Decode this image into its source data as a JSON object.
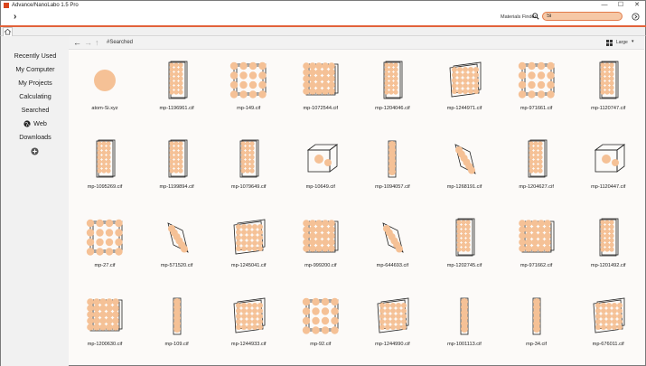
{
  "window": {
    "title": "Advance/NanoLabo 1.5 Pro",
    "controls": [
      "—",
      "☐",
      "✕"
    ]
  },
  "toolbar": {
    "menu_glyph": "›",
    "finder_label": "Materials Finder",
    "finder_value": "Si"
  },
  "sidebar": {
    "items": [
      {
        "label": "Recently Used"
      },
      {
        "label": "My Computer"
      },
      {
        "label": "My Projects"
      },
      {
        "label": "Calculating"
      },
      {
        "label": "Searched"
      },
      {
        "label": "Web",
        "icon": "globe-icon"
      },
      {
        "label": "Downloads"
      }
    ],
    "add_icon": "plus-circle-icon"
  },
  "navbar": {
    "back": "←",
    "forward": "→",
    "up": "↑",
    "breadcrumb": "#Searched",
    "view_label": "Large",
    "view_caret": "▾"
  },
  "colors": {
    "accent": "#e2623a",
    "atom": "#f5c196",
    "search_bg": "#f6c8a6"
  },
  "files": [
    {
      "name": "atom-Si.xyz",
      "kind": "atom"
    },
    {
      "name": "mp-1196961.cif",
      "kind": "tall"
    },
    {
      "name": "mp-149.cif",
      "kind": "cube-lattice"
    },
    {
      "name": "mp-1072544.cif",
      "kind": "cube-dense"
    },
    {
      "name": "mp-1204046.cif",
      "kind": "tall"
    },
    {
      "name": "mp-1244971.cif",
      "kind": "skew"
    },
    {
      "name": "mp-971661.cif",
      "kind": "cube-lattice"
    },
    {
      "name": "mp-1120747.cif",
      "kind": "tall"
    },
    {
      "name": "mp-1095269.cif",
      "kind": "tall"
    },
    {
      "name": "mp-1199894.cif",
      "kind": "tall"
    },
    {
      "name": "mp-1079649.cif",
      "kind": "tall"
    },
    {
      "name": "mp-10649.cif",
      "kind": "sparse"
    },
    {
      "name": "mp-1094057.cif",
      "kind": "column"
    },
    {
      "name": "mp-1268191.cif",
      "kind": "parallelogram"
    },
    {
      "name": "mp-1204627.cif",
      "kind": "tall"
    },
    {
      "name": "mp-1120447.cif",
      "kind": "sparse"
    },
    {
      "name": "mp-27.cif",
      "kind": "cube-lattice"
    },
    {
      "name": "mp-571520.cif",
      "kind": "parallelogram"
    },
    {
      "name": "mp-1245041.cif",
      "kind": "skew"
    },
    {
      "name": "mp-999200.cif",
      "kind": "cube-dense"
    },
    {
      "name": "mp-644693.cif",
      "kind": "parallelogram"
    },
    {
      "name": "mp-1202745.cif",
      "kind": "tall"
    },
    {
      "name": "mp-971662.cif",
      "kind": "cube-dense"
    },
    {
      "name": "mp-1201492.cif",
      "kind": "tall"
    },
    {
      "name": "mp-1200630.cif",
      "kind": "cube-dense"
    },
    {
      "name": "mp-109.cif",
      "kind": "column"
    },
    {
      "name": "mp-1244933.cif",
      "kind": "skew"
    },
    {
      "name": "mp-92.cif",
      "kind": "cube-lattice"
    },
    {
      "name": "mp-1244990.cif",
      "kind": "skew"
    },
    {
      "name": "mp-1001113.cif",
      "kind": "column"
    },
    {
      "name": "mp-34.cif",
      "kind": "column"
    },
    {
      "name": "mp-676011.cif",
      "kind": "skew"
    }
  ]
}
